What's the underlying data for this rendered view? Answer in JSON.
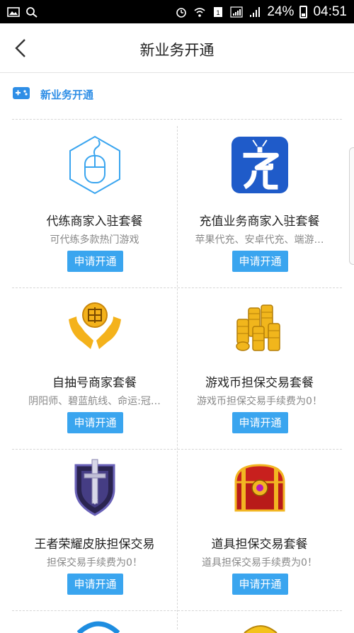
{
  "status_bar": {
    "battery": "24%",
    "time": "04:51"
  },
  "nav": {
    "title": "新业务开通"
  },
  "section": {
    "title": "新业务开通"
  },
  "items": [
    {
      "title": "代练商家入驻套餐",
      "subtitle": "可代练多款热门游戏",
      "button": "申请开通",
      "icon": "mouse-hexagon-icon"
    },
    {
      "title": "充值业务商家入驻套餐",
      "subtitle": "苹果代充、安卓代充、端游…",
      "button": "申请开通",
      "icon": "recharge-app-icon"
    },
    {
      "title": "自抽号商家套餐",
      "subtitle": "阴阳师、碧蓝航线、命运:冠…",
      "button": "申请开通",
      "icon": "hands-coin-icon"
    },
    {
      "title": "游戏币担保交易套餐",
      "subtitle": "游戏币担保交易手续费为0！",
      "button": "申请开通",
      "icon": "coin-stack-icon"
    },
    {
      "title": "王者荣耀皮肤担保交易",
      "subtitle": "担保交易手续费为0！",
      "button": "申请开通",
      "icon": "sword-shield-icon"
    },
    {
      "title": "道具担保交易套餐",
      "subtitle": "道具担保交易手续费为0！",
      "button": "申请开通",
      "icon": "treasure-chest-icon"
    }
  ],
  "colors": {
    "accent": "#3aa5ef",
    "section_title": "#2e8ee6",
    "statusbar": "#000000"
  }
}
